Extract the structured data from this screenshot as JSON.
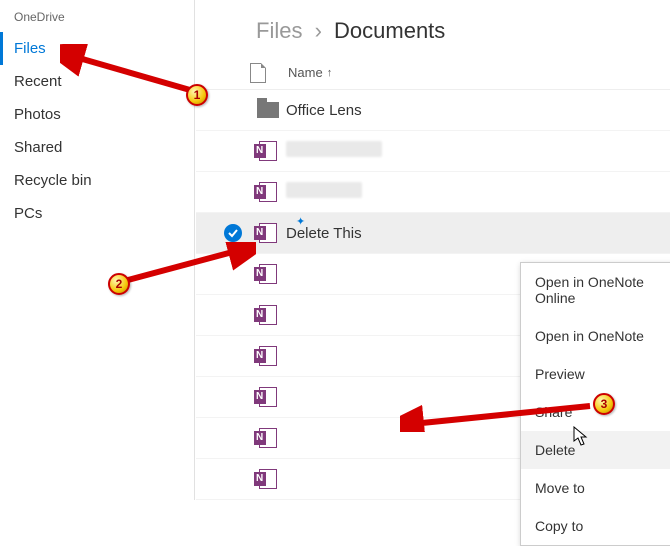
{
  "app_title": "OneDrive",
  "sidebar": {
    "items": [
      {
        "label": "Files",
        "active": true
      },
      {
        "label": "Recent",
        "active": false
      },
      {
        "label": "Photos",
        "active": false
      },
      {
        "label": "Shared",
        "active": false
      },
      {
        "label": "Recycle bin",
        "active": false
      },
      {
        "label": "PCs",
        "active": false
      }
    ]
  },
  "breadcrumb": {
    "root": "Files",
    "current": "Documents"
  },
  "list_header": {
    "name_label": "Name",
    "sort_arrow": "↑"
  },
  "files": [
    {
      "type": "folder",
      "name": "Office Lens",
      "redacted": false,
      "selected": false
    },
    {
      "type": "onenote",
      "name": "",
      "redacted": true,
      "redact_w": 96,
      "selected": false
    },
    {
      "type": "onenote",
      "name": "",
      "redacted": true,
      "redact_w": 76,
      "selected": false
    },
    {
      "type": "onenote",
      "name": "Delete This",
      "redacted": false,
      "selected": true
    },
    {
      "type": "onenote",
      "name": "",
      "redacted": true,
      "redact_w": 0,
      "selected": false
    },
    {
      "type": "onenote",
      "name": "",
      "redacted": true,
      "redact_w": 0,
      "selected": false
    },
    {
      "type": "onenote",
      "name": "",
      "redacted": true,
      "redact_w": 0,
      "selected": false
    },
    {
      "type": "onenote",
      "name": "",
      "redacted": true,
      "redact_w": 0,
      "selected": false
    },
    {
      "type": "onenote",
      "name": "",
      "redacted": true,
      "redact_w": 0,
      "selected": false
    },
    {
      "type": "onenote",
      "name": "",
      "redacted": true,
      "redact_w": 0,
      "selected": false
    }
  ],
  "context_menu": {
    "items": [
      "Open in OneNote Online",
      "Open in OneNote",
      "Preview",
      "Share",
      "Delete",
      "Move to",
      "Copy to"
    ],
    "hover_index": 4
  },
  "annotations": {
    "badge1": "1",
    "badge2": "2",
    "badge3": "3"
  }
}
